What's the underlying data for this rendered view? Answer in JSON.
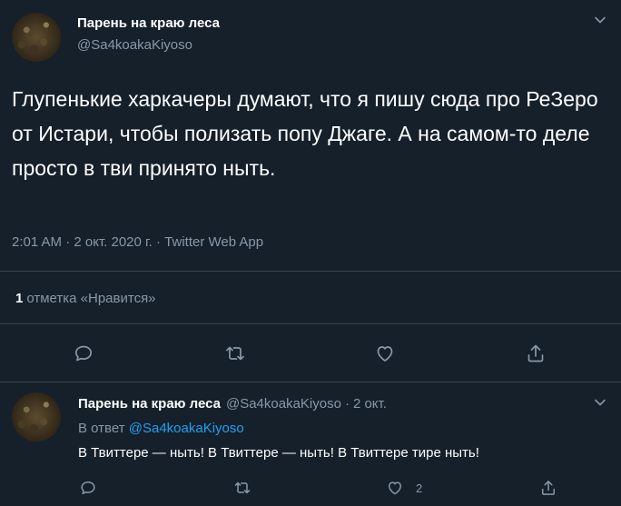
{
  "tweet": {
    "author_name": "Парень на краю леса",
    "author_handle": "@Sa4koakaKiyoso",
    "text": "Глупенькие харкачеры думают, что я пишу сюда про РеЗеро от Истари, чтобы полизать попу Джаге. А на самом-то деле просто в тви принято ныть.",
    "meta": "2:01 AM · 2 окт. 2020 г. · Twitter Web App",
    "likes_count": "1",
    "likes_label": "отметка «Нравится»"
  },
  "reply": {
    "author_name": "Парень на краю леса",
    "author_handle": "@Sa4koakaKiyoso",
    "separator": "·",
    "date": "2 окт.",
    "in_reply_prefix": "В ответ",
    "in_reply_handle": "@Sa4koakaKiyoso",
    "text": "В Твиттере — ныть! В Твиттере — ныть! В Твиттере тире ныть!",
    "like_count": "2"
  },
  "icons": {
    "reply": "reply-icon",
    "retweet": "retweet-icon",
    "like": "heart-icon",
    "share": "share-icon",
    "more": "chevron-down-icon"
  },
  "colors": {
    "background": "#15202b",
    "secondary_text": "#8899a6",
    "link": "#1da1f2",
    "divider": "#38444d"
  }
}
